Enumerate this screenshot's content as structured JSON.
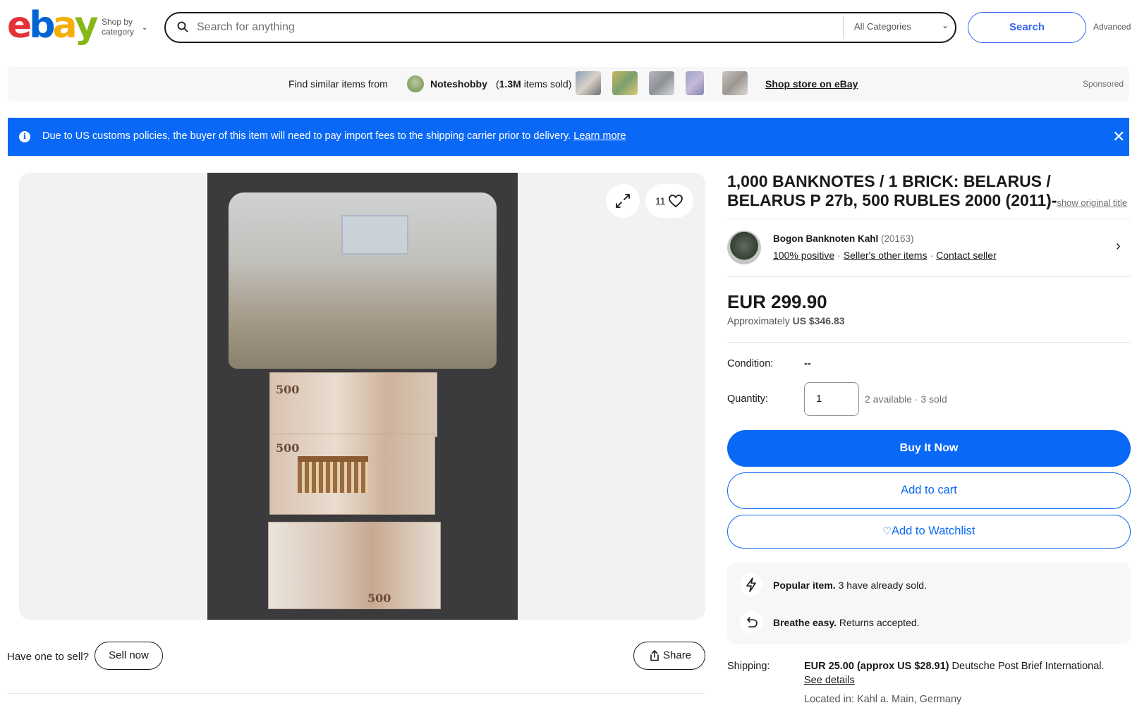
{
  "header": {
    "logo_letters": [
      "e",
      "b",
      "a",
      "y"
    ],
    "logo_colors": [
      "#e53238",
      "#0064d2",
      "#f5af02",
      "#86b817"
    ],
    "shop_by_line1": "Shop by",
    "shop_by_line2": "category",
    "search_placeholder": "Search for anything",
    "category_selected": "All Categories",
    "search_button": "Search",
    "advanced_link": "Advanced"
  },
  "sponsored": {
    "find_similar": "Find similar items from",
    "store_name": "Noteshobby",
    "store_sold_count": "1.3M",
    "store_sold_suffix": "items sold)",
    "store_sold_prefix": "(",
    "shop_store_link": "Shop store on eBay",
    "label": "Sponsored"
  },
  "banner": {
    "icon": "info-icon",
    "text": "Due to US customs policies, the buyer of this item will need to pay import fees to the shipping carrier prior to delivery.",
    "link": "Learn more",
    "close_icon": "close-icon",
    "color": "#0968f6"
  },
  "gallery": {
    "watch_count": "11",
    "expand_icon": "expand-icon",
    "heart_icon": "heart-icon",
    "note_denomination": "500"
  },
  "below_image": {
    "have_one": "Have one to sell?",
    "sell_now": "Sell now",
    "share": "Share"
  },
  "listing": {
    "title": "1,000 BANKNOTES / 1 BRICK: BELARUS / BELARUS P 27b, 500 RUBLES 2000 (2011)-",
    "show_original": "show original title",
    "seller": {
      "name": "Bogon Banknoten Kahl",
      "score": "(20163)",
      "positive": "100% positive",
      "other_items": "Seller's other items",
      "contact": "Contact seller"
    },
    "price": "EUR 299.90",
    "approx_prefix": "Approximately",
    "approx_value": "US $346.83",
    "condition_label": "Condition:",
    "condition_value": "--",
    "quantity_label": "Quantity:",
    "quantity_value": "1",
    "available": "2 available · 3 sold",
    "buy_now": "Buy It Now",
    "add_to_cart": "Add to cart",
    "add_to_watchlist": "Add to Watchlist",
    "popular_bold": "Popular item.",
    "popular_text": "3 have already sold.",
    "breathe_bold": "Breathe easy.",
    "breathe_text": "Returns accepted.",
    "shipping_label": "Shipping:",
    "shipping_bold": "EUR 25.00 (approx US $28.91)",
    "shipping_text": "Deutsche Post Brief International.",
    "see_details": "See details",
    "located_in": "Located in: Kahl a. Main, Germany"
  },
  "colors": {
    "accent": "#3665f3",
    "primary_button": "#0968f6"
  }
}
